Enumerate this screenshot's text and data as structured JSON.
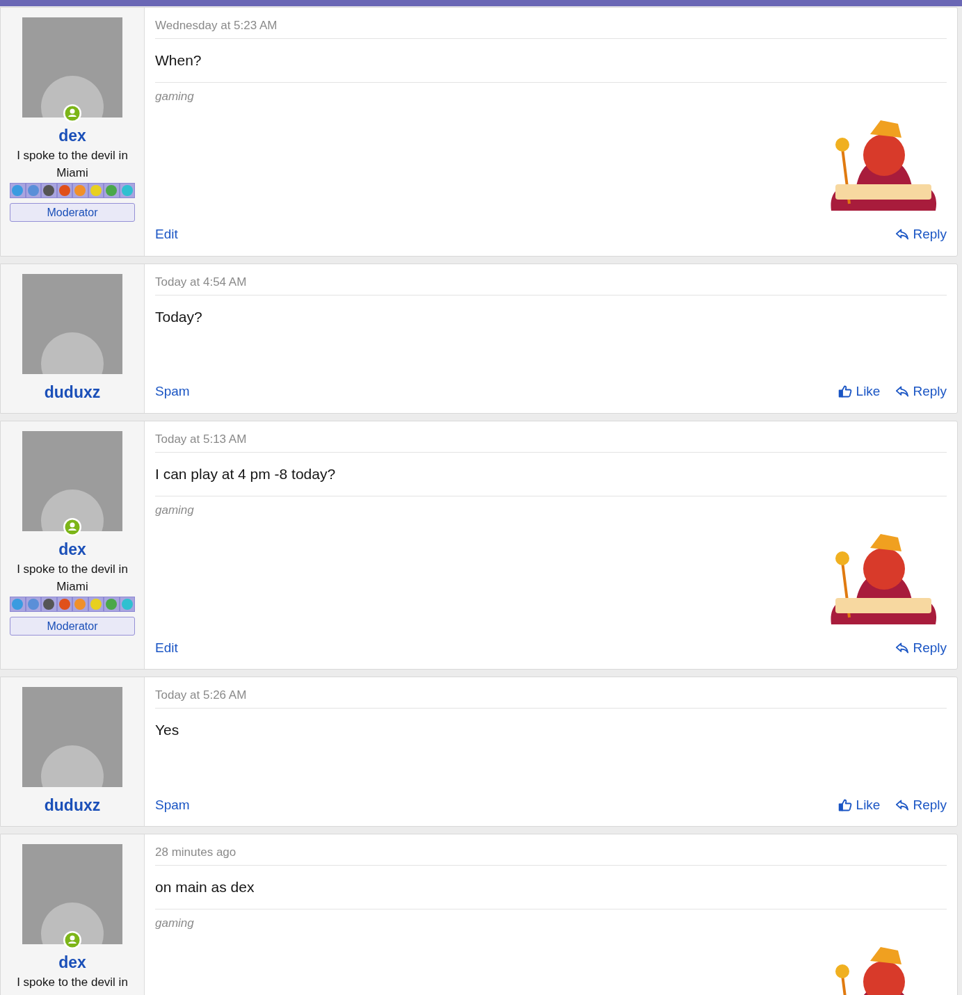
{
  "posts": [
    {
      "user": {
        "name": "dex",
        "online": true,
        "title": "I spoke to the devil in Miami",
        "badges": [
          {
            "color": "#3a9be0"
          },
          {
            "color": "#5a8fd8"
          },
          {
            "color": "#555555"
          },
          {
            "color": "#e0501a"
          },
          {
            "color": "#f0902a"
          },
          {
            "color": "#e8d020"
          },
          {
            "color": "#4aa84a"
          },
          {
            "color": "#30c0d0"
          }
        ],
        "role": "Moderator"
      },
      "time": "Wednesday at 5:23 AM",
      "message": "When?",
      "signature": {
        "text": "gaming"
      },
      "actions": [
        "Edit"
      ],
      "reply": "Reply"
    },
    {
      "user": {
        "name": "duduxz",
        "online": false
      },
      "time": "Today at 4:54 AM",
      "message": "Today?",
      "actions": [
        "Spam"
      ],
      "like": "Like",
      "reply": "Reply"
    },
    {
      "user": {
        "name": "dex",
        "online": true,
        "title": "I spoke to the devil in Miami",
        "badges": [
          {
            "color": "#3a9be0"
          },
          {
            "color": "#5a8fd8"
          },
          {
            "color": "#555555"
          },
          {
            "color": "#e0501a"
          },
          {
            "color": "#f0902a"
          },
          {
            "color": "#e8d020"
          },
          {
            "color": "#4aa84a"
          },
          {
            "color": "#30c0d0"
          }
        ],
        "role": "Moderator"
      },
      "time": "Today at 5:13 AM",
      "message": "I can play at 4 pm -8 today?",
      "signature": {
        "text": "gaming"
      },
      "actions": [
        "Edit"
      ],
      "reply": "Reply"
    },
    {
      "user": {
        "name": "duduxz",
        "online": false
      },
      "time": "Today at 5:26 AM",
      "message": "Yes",
      "actions": [
        "Spam"
      ],
      "like": "Like",
      "reply": "Reply"
    },
    {
      "user": {
        "name": "dex",
        "online": true,
        "title": "I spoke to the devil in"
      },
      "time": "28 minutes ago",
      "message": "on main as dex",
      "signature": {
        "text": "gaming"
      }
    }
  ]
}
